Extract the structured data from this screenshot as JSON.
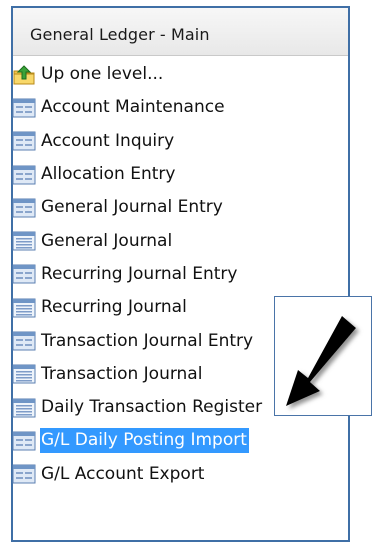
{
  "panel": {
    "title": "General Ledger - Main",
    "items": [
      {
        "label": "Up one level...",
        "icon": "folder-up-icon"
      },
      {
        "label": "Account Maintenance",
        "icon": "form-icon"
      },
      {
        "label": "Account Inquiry",
        "icon": "form-icon"
      },
      {
        "label": "Allocation Entry",
        "icon": "form-icon"
      },
      {
        "label": "General Journal Entry",
        "icon": "form-icon"
      },
      {
        "label": "General Journal",
        "icon": "report-icon"
      },
      {
        "label": "Recurring Journal Entry",
        "icon": "form-icon"
      },
      {
        "label": "Recurring Journal",
        "icon": "report-icon"
      },
      {
        "label": "Transaction Journal Entry",
        "icon": "form-icon"
      },
      {
        "label": "Transaction Journal",
        "icon": "report-icon"
      },
      {
        "label": "Daily Transaction Register",
        "icon": "report-icon"
      },
      {
        "label": "G/L Daily Posting Import",
        "icon": "form-icon",
        "selected": true
      },
      {
        "label": "G/L Account Export",
        "icon": "form-icon"
      }
    ]
  },
  "colors": {
    "border": "#3f6fa6",
    "selection": "#3399ff",
    "icon_frame": "#5b7fb1"
  }
}
